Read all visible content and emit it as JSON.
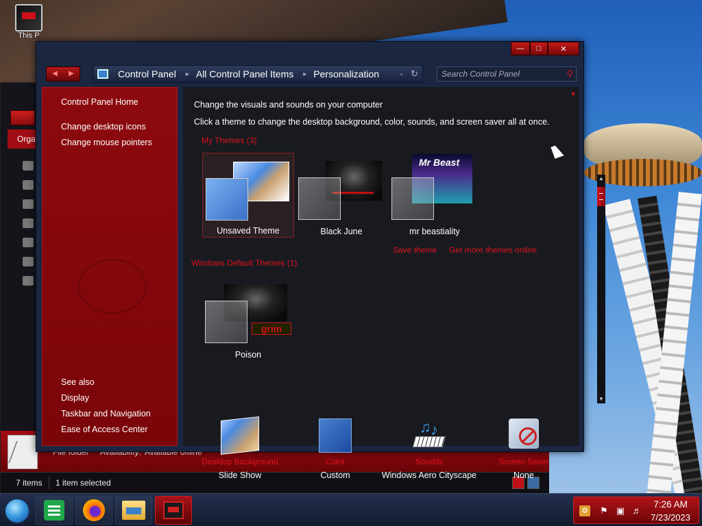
{
  "desktop": {
    "icon_label": "This P"
  },
  "explorer": {
    "org_label": "Orga",
    "details_type": "File folder",
    "details_availability_label": "Availability:",
    "details_availability_value": "Available offline",
    "status_items": "7 items",
    "status_selected": "1 item selected"
  },
  "window": {
    "breadcrumb": [
      "Control Panel",
      "All Control Panel Items",
      "Personalization"
    ],
    "search_placeholder": "Search Control Panel",
    "caption_buttons": [
      "minimize",
      "maximize",
      "close"
    ]
  },
  "left_pane": {
    "home": "Control Panel Home",
    "links": [
      "Change desktop icons",
      "Change mouse pointers"
    ],
    "see_also_title": "See also",
    "see_also": [
      "Display",
      "Taskbar and Navigation",
      "Ease of Access Center"
    ]
  },
  "content": {
    "heading": "Change the visuals and sounds on your computer",
    "subheading": "Click a theme to change the desktop background, color, sounds, and screen saver all at once.",
    "my_themes_title": "My Themes (3)",
    "my_themes": [
      {
        "name": "Unsaved Theme",
        "selected": true
      },
      {
        "name": "Black June",
        "selected": false
      },
      {
        "name": "mr beastiality",
        "selected": false,
        "image_text": "Mr Beast"
      }
    ],
    "save_theme": "Save theme",
    "get_more": "Get more themes online",
    "default_themes_title": "Windows Default Themes (1)",
    "default_themes": [
      {
        "name": "Poison",
        "image_text": "grim"
      }
    ],
    "bottom_items": [
      {
        "label": "Desktop Background",
        "value": "Slide Show",
        "icon": "desktop-background-icon"
      },
      {
        "label": "Color",
        "value": "Custom",
        "icon": "color-swatch-icon"
      },
      {
        "label": "Sounds",
        "value": "Windows Aero Cityscape",
        "icon": "sounds-icon"
      },
      {
        "label": "Screen Saver",
        "value": "None",
        "icon": "screen-saver-icon"
      }
    ]
  },
  "taskbar": {
    "apps": [
      "sheets-app",
      "firefox",
      "file-explorer",
      "control-panel"
    ],
    "time": "7:26 AM",
    "date": "7/23/2023"
  },
  "colors": {
    "accent_red": "#e0141c",
    "pane_red": "#8d0a0f",
    "window_blue": "#1b2640"
  }
}
